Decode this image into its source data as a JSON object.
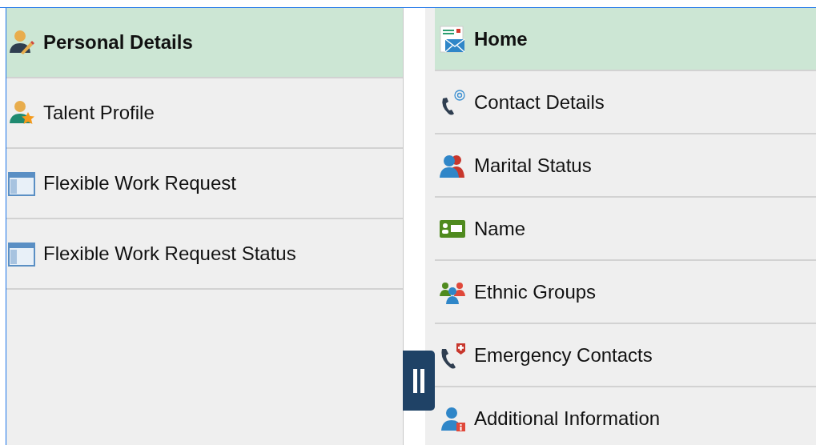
{
  "left_menu": {
    "items": [
      {
        "label": "Personal Details",
        "selected": true,
        "kind": "person-pencil"
      },
      {
        "label": "Talent Profile",
        "selected": false,
        "kind": "person-star"
      },
      {
        "label": "Flexible Work Request",
        "selected": false,
        "kind": "window"
      },
      {
        "label": "Flexible Work Request Status",
        "selected": false,
        "kind": "window"
      }
    ]
  },
  "right_menu": {
    "items": [
      {
        "label": "Home",
        "selected": true,
        "kind": "mail"
      },
      {
        "label": "Contact Details",
        "selected": false,
        "kind": "phone"
      },
      {
        "label": "Marital Status",
        "selected": false,
        "kind": "couple"
      },
      {
        "label": "Name",
        "selected": false,
        "kind": "card"
      },
      {
        "label": "Ethnic Groups",
        "selected": false,
        "kind": "group"
      },
      {
        "label": "Emergency Contacts",
        "selected": false,
        "kind": "emergency"
      },
      {
        "label": "Additional Information",
        "selected": false,
        "kind": "info"
      }
    ]
  }
}
